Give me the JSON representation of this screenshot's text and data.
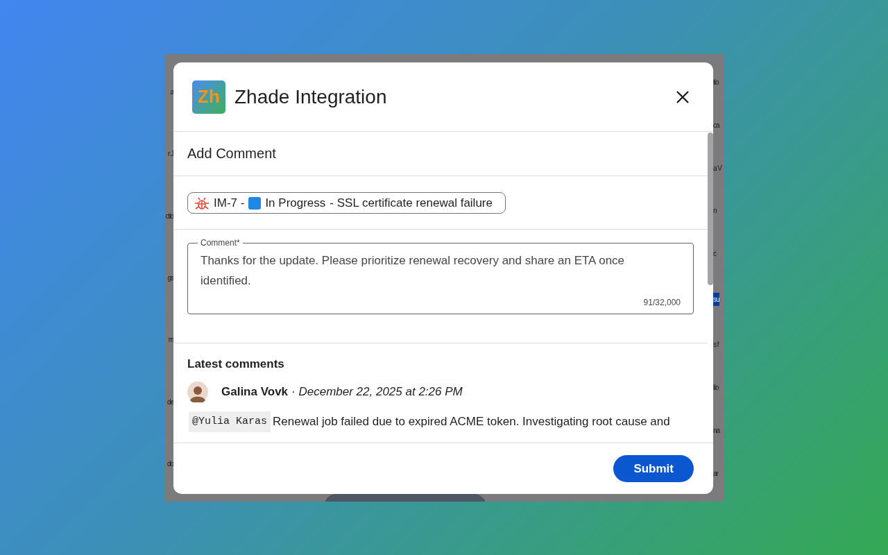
{
  "backdrop": {
    "left_fragments": [
      {
        "kind": "text",
        "text": "a"
      },
      {
        "kind": "text",
        "text": "r J"
      },
      {
        "kind": "text",
        "text": "ctio"
      },
      {
        "kind": "text",
        "text": "gs"
      },
      {
        "kind": "text",
        "text": "m"
      },
      {
        "kind": "text",
        "text": "de"
      },
      {
        "kind": "text",
        "text": "do"
      }
    ],
    "right_fragments": [
      {
        "kind": "text",
        "text": "tio"
      },
      {
        "kind": "text",
        "text": "ca"
      },
      {
        "kind": "text",
        "text": "a V"
      },
      {
        "kind": "text",
        "text": "n"
      },
      {
        "kind": "text",
        "text": "c"
      },
      {
        "kind": "button",
        "text": "su"
      },
      {
        "kind": "text",
        "text": "s f"
      },
      {
        "kind": "text",
        "text": "tio"
      },
      {
        "kind": "text",
        "text": "na"
      },
      {
        "kind": "text",
        "text": "ar"
      }
    ]
  },
  "dialog": {
    "logo": "Zh",
    "title": "Zhade Integration",
    "section_title": "Add Comment",
    "issue": {
      "key": "IM-7 -",
      "status": "In Progress",
      "color": "#1e88e5",
      "summary": "- SSL certificate renewal failure"
    },
    "comment_field": {
      "label": "Comment*",
      "value": "Thanks for the update. Please prioritize renewal recovery and share an ETA once identified.",
      "counter": "91/32,000"
    },
    "latest_title": "Latest comments",
    "comments": [
      {
        "author": "Galina Vovk",
        "meta": "· December 22, 2025 at 2:26 PM",
        "mention": "@Yulia Karas",
        "text": "Renewal job failed due to expired ACME token. Investigating root cause and"
      }
    ],
    "submit": "Submit"
  }
}
